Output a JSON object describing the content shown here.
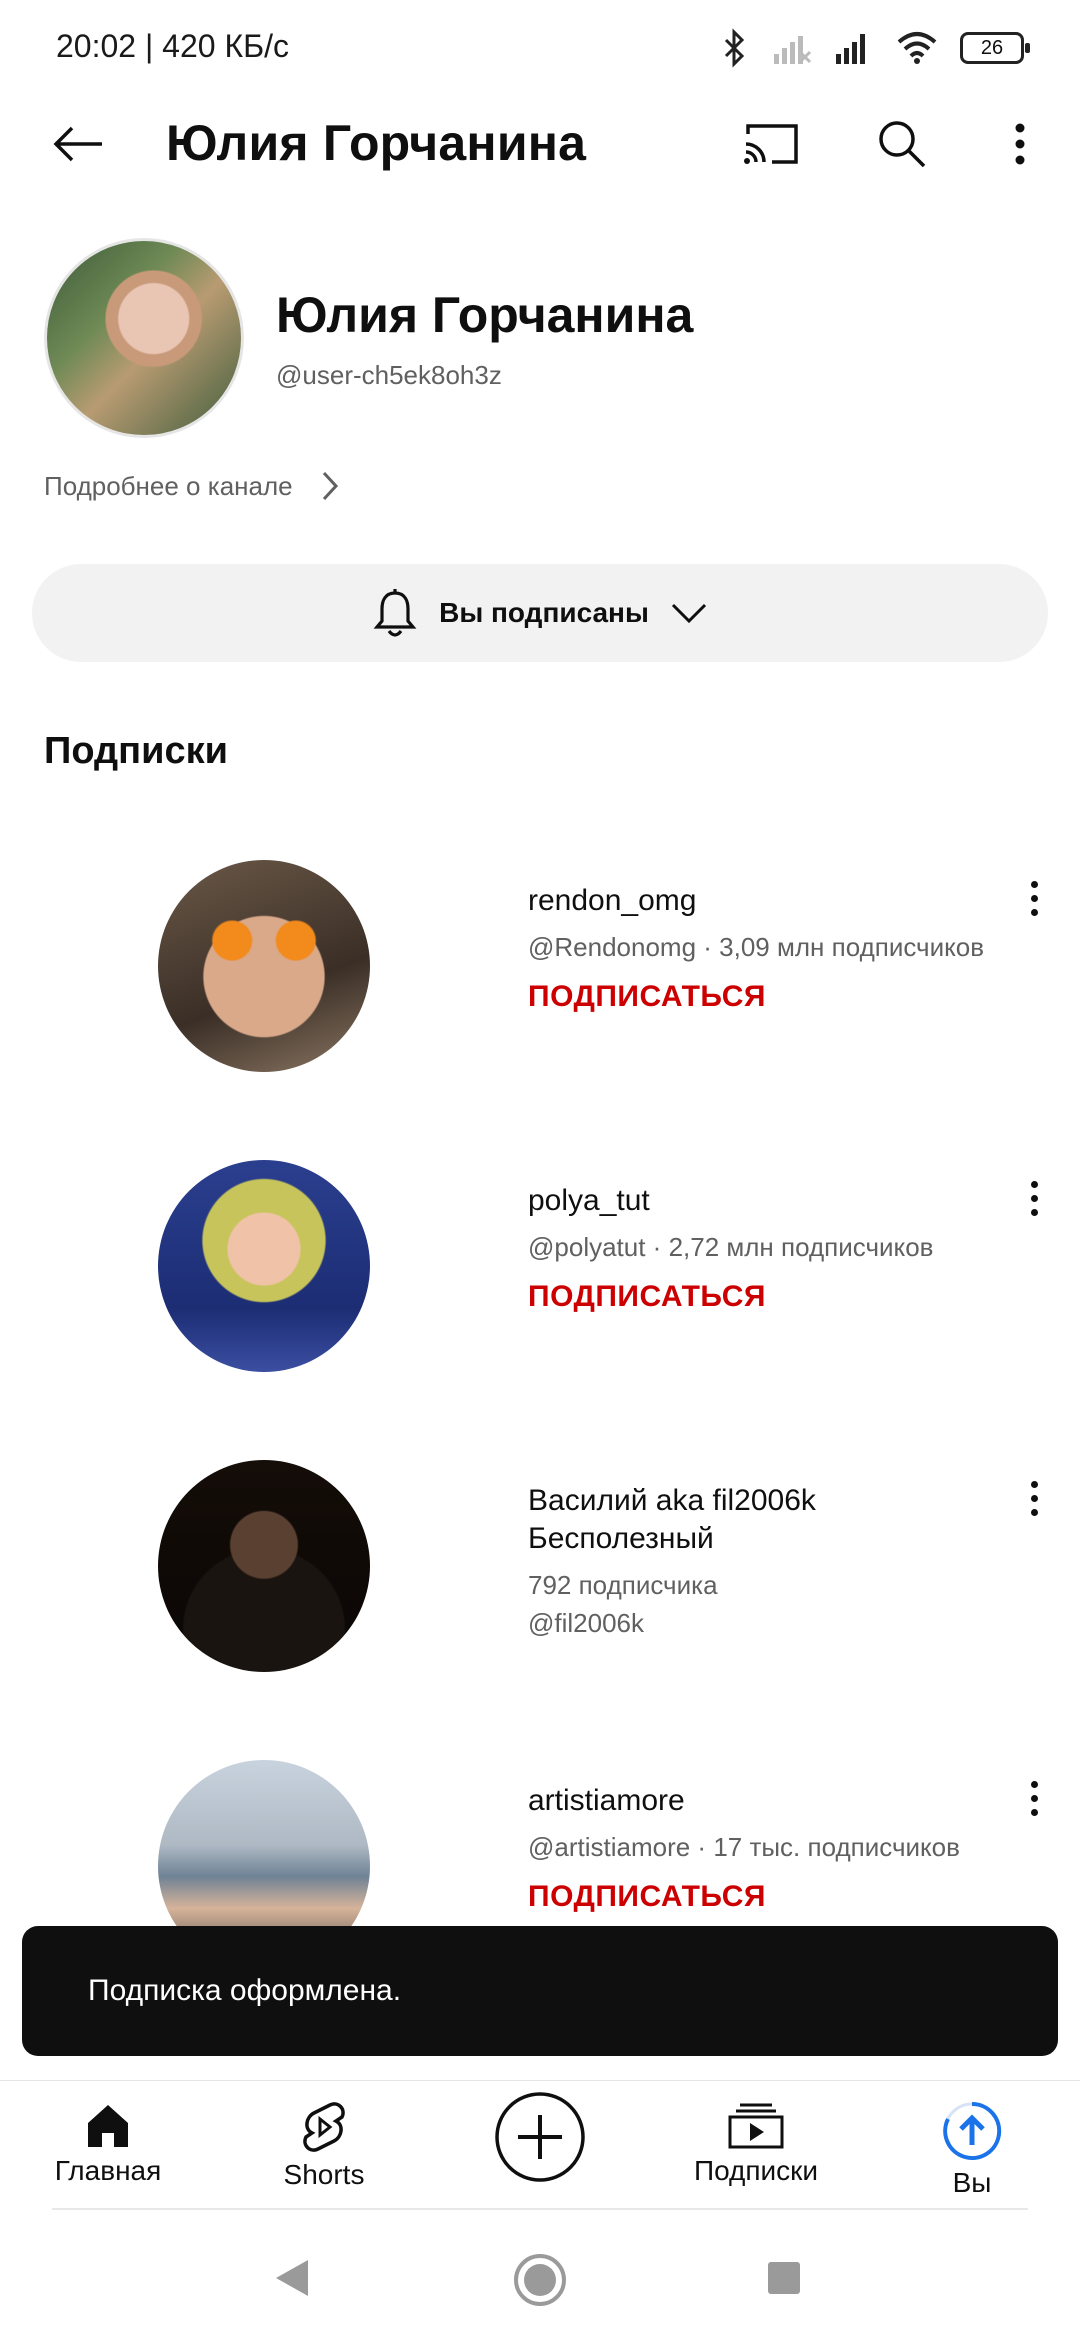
{
  "status_bar": {
    "time_speed": "20:02 | 420 КБ/с",
    "battery": "26",
    "icons": [
      "bluetooth-icon",
      "signal-off-icon",
      "signal-icon",
      "wifi-icon",
      "battery-icon"
    ]
  },
  "topbar": {
    "title": "Юлия Горчанина",
    "icons": [
      "back-arrow-icon",
      "cast-icon",
      "search-icon",
      "more-vert-icon"
    ]
  },
  "channel": {
    "name": "Юлия Горчанина",
    "handle": "@user-ch5ek8oh3z",
    "more_about": "Подробнее о канале",
    "subscribed_label": "Вы подписаны"
  },
  "subscriptions": {
    "title": "Подписки",
    "items": [
      {
        "name": "rendon_omg",
        "meta": "@Rendonomg · 3,09 млн подписчиков",
        "action": "ПОДПИСАТЬСЯ"
      },
      {
        "name": "polya_tut",
        "meta": "@polyatut · 2,72 млн подписчиков",
        "action": "ПОДПИСАТЬСЯ"
      },
      {
        "name": "Василий aka fil2006k Бесполезный",
        "meta": "792 подписчика",
        "meta2": "@fil2006k"
      },
      {
        "name": "artistiamore",
        "meta": "@artistiamore · 17 тыс. подписчиков",
        "action": "ПОДПИСАТЬСЯ"
      }
    ]
  },
  "snackbar": {
    "text": "Подписка оформлена."
  },
  "bottom_nav": {
    "items": [
      {
        "label": "Главная",
        "icon": "home-icon"
      },
      {
        "label": "Shorts",
        "icon": "shorts-icon"
      },
      {
        "label": "",
        "icon": "create-plus-icon"
      },
      {
        "label": "Подписки",
        "icon": "subscriptions-icon"
      },
      {
        "label": "Вы",
        "icon": "you-avatar-icon"
      }
    ]
  },
  "system_nav": [
    "back-triangle-icon",
    "home-circle-icon",
    "recents-square-icon"
  ],
  "colors": {
    "accent_red": "#cc0000",
    "text_primary": "#0f0f0f",
    "text_secondary": "#606060",
    "button_bg": "#f2f2f2"
  }
}
